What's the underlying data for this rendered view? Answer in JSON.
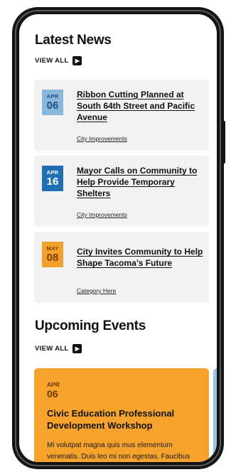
{
  "latest_news": {
    "title": "Latest News",
    "view_all": "VIEW ALL",
    "items": [
      {
        "month": "APR",
        "day": "06",
        "headline": "Ribbon Cutting Planned at South 64th Street and Pacific Avenue",
        "category": "City Improvements"
      },
      {
        "month": "APR",
        "day": "16",
        "headline": "Mayor Calls on Community to Help Provide Temporary Shelters",
        "category": "City Improvements"
      },
      {
        "month": "MAY",
        "day": "08",
        "headline": "City Invites Community to Help Shape Tacoma’s Future",
        "category": "Category Here"
      }
    ]
  },
  "upcoming_events": {
    "title": "Upcoming Events",
    "view_all": "VIEW ALL",
    "items": [
      {
        "month": "APR",
        "day": "06",
        "title": "Civic Education Professional Development Workshop",
        "description": "Mi volutpat magna quis mus elementum venenatis. Duis leo mi non egestas. Faucibus amet a at nisl. Suspendisse dui"
      }
    ]
  },
  "colors": {
    "badge_light": "#8ab7dc",
    "badge_blue": "#1f6fb5",
    "badge_orange": "#f3a02c",
    "event_card": "#f5a32d",
    "card_bg": "#f2f2f2"
  },
  "icons": {
    "view_all_arrow": "chevron-right-icon"
  }
}
